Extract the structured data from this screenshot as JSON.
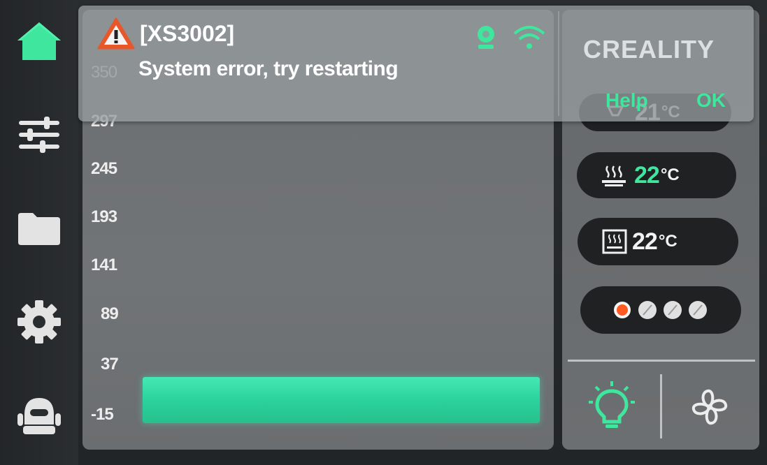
{
  "notification": {
    "code": "[XS3002]",
    "message": "System error, try restarting",
    "brand": "CREALITY",
    "help_label": "Help",
    "ok_label": "OK"
  },
  "chart": {
    "y_ticks": [
      "350",
      "297",
      "245",
      "193",
      "141",
      "89",
      "37",
      "-15"
    ]
  },
  "chart_data": {
    "type": "bar",
    "y_ticks": [
      350,
      297,
      245,
      193,
      141,
      89,
      37,
      -15
    ],
    "ylim": [
      -15,
      350
    ],
    "grid": false
  },
  "sidebar": {
    "items": [
      {
        "icon": "home-icon",
        "active": true
      },
      {
        "icon": "sliders-icon",
        "active": false
      },
      {
        "icon": "folder-icon",
        "active": false
      },
      {
        "icon": "gear-icon",
        "active": false
      },
      {
        "icon": "robot-icon",
        "active": false
      }
    ]
  },
  "status": {
    "nozzle": {
      "temp": "21",
      "unit": "°C"
    },
    "bed": {
      "temp": "22",
      "unit": "°C"
    },
    "chamber": {
      "temp": "22",
      "unit": "°C"
    }
  },
  "colors": {
    "accent": "#3fe69d",
    "warning": "#e8572a",
    "panel": "#6e7173",
    "pill": "#1f2123"
  }
}
